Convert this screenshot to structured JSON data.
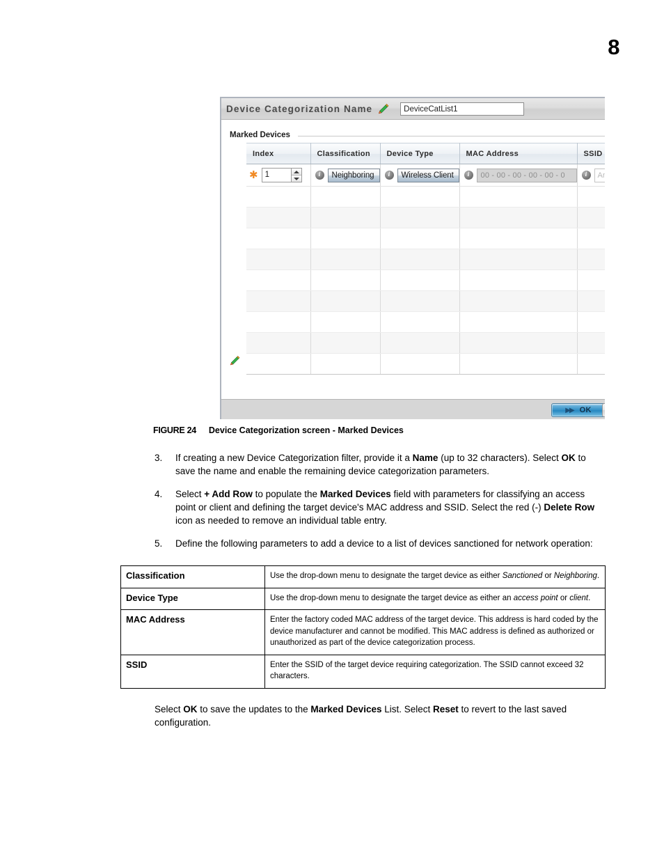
{
  "page": {
    "number": "8"
  },
  "screenshot": {
    "titlebar": {
      "label": "Device Categorization Name",
      "edit_icon": "pencil-icon",
      "name_value": "DeviceCatList1"
    },
    "group": {
      "label": "Marked Devices"
    },
    "edit_row_icon": "pencil-icon",
    "table": {
      "columns": [
        "Index",
        "Classification",
        "Device Type",
        "MAC Address",
        "SSID"
      ],
      "row": {
        "required_marker": "✱",
        "index": "1",
        "classification": "Neighboring",
        "device_type": "Wireless Client",
        "mac_address": "00 - 00 - 00 - 00 - 00 - 0",
        "ssid_placeholder": "An",
        "info_icon": "i"
      },
      "empty_row_count": 9
    },
    "footer": {
      "ok_label": "OK",
      "ok_chevron": "▶▶"
    }
  },
  "figure": {
    "label": "FIGURE 24",
    "caption": "Device Categorization screen - Marked Devices"
  },
  "steps": [
    {
      "number": "3.",
      "html": "If creating a new Device Categorization filter, provide it a <b>Name</b> (up to 32 characters). Select <b>OK</b> to save the name and enable the remaining device categorization parameters."
    },
    {
      "number": "4.",
      "html": "Select <b>+ Add Row</b> to populate the <b>Marked Devices</b> field with parameters for classifying an access point or client and defining the target device's MAC address and SSID. Select the red (-) <b>Delete Row</b> icon as needed to remove an individual table entry."
    },
    {
      "number": "5.",
      "html": "Define the following parameters to add a device to a list of devices sanctioned for network operation:"
    }
  ],
  "param_table": {
    "rows": [
      {
        "name": "Classification",
        "desc_html": "Use the drop-down menu to designate the target device as either <i>Sanctioned</i> or <i>Neighboring</i>."
      },
      {
        "name": "Device Type",
        "desc_html": "Use the drop-down menu to designate the target device as either an <i>access point</i> or <i>client</i>."
      },
      {
        "name": "MAC Address",
        "desc_html": "Enter the factory coded MAC address of the target device. This address is hard coded by the device manufacturer and cannot be modified. This MAC address is defined as authorized or unauthorized as part of the device categorization process."
      },
      {
        "name": "SSID",
        "desc_html": "Enter the SSID of the target device requiring categorization. The SSID cannot exceed 32 characters."
      }
    ]
  },
  "closing": {
    "html": "Select <b>OK</b> to save the updates to the <b>Marked Devices</b> List. Select <b>Reset</b> to revert to the last saved configuration."
  }
}
